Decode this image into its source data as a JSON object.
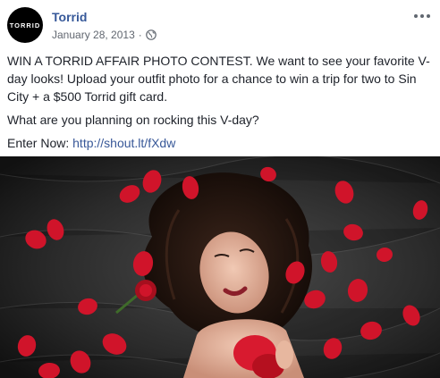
{
  "post": {
    "page_name": "Torrid",
    "avatar_logo_text": "TORRID",
    "date": "January 28, 2013",
    "separator": "·",
    "privacy_icon": "globe-icon",
    "more_icon": "more-options-icon",
    "paragraphs": [
      "WIN A TORRID AFFAIR PHOTO CONTEST. We want to see your favorite V-day looks! Upload your outfit photo for a chance to win a trip for two to Sin City + a $500 Torrid gift card.",
      "What are you planning on rocking this V-day?"
    ],
    "enter_now_prefix": "Enter Now: ",
    "link": "http://shout.lt/fXdw",
    "colors": {
      "link": "#385898",
      "page_name": "#365899",
      "meta": "#616770",
      "rose": "#d0142a"
    }
  }
}
